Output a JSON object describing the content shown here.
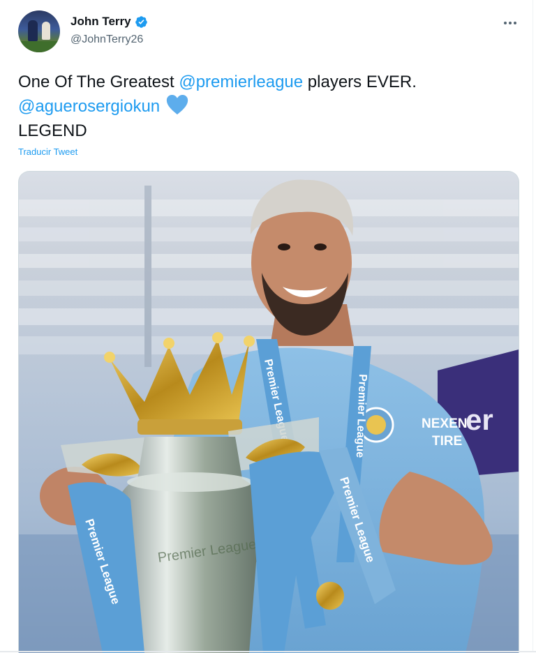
{
  "author": {
    "name": "John Terry",
    "handle": "@JohnTerry26",
    "verified": true,
    "avatar_icon": "avatar-photo"
  },
  "tweet": {
    "line1_prefix": "One Of The Greatest ",
    "line1_mention": "@premierleague",
    "line1_suffix": " players EVER.",
    "line2_mention": "@aguerosergiokun",
    "line2_emoji": "blue-heart-icon",
    "line3": "LEGEND"
  },
  "translate_label": "Traducir Tweet",
  "more_icon": "more-options-icon",
  "media": {
    "sash_text": "Premier League",
    "sponsor_text_1": "NEXEN",
    "sponsor_text_2": "TIRE",
    "board_text": "er",
    "trophy_text": "Premier League"
  },
  "colors": {
    "link": "#1d9bf0",
    "text": "#0f1419",
    "secondary": "#536471",
    "verified": "#1d9bf0",
    "heart": "#5dadec",
    "jersey": "#7fb3dc"
  }
}
